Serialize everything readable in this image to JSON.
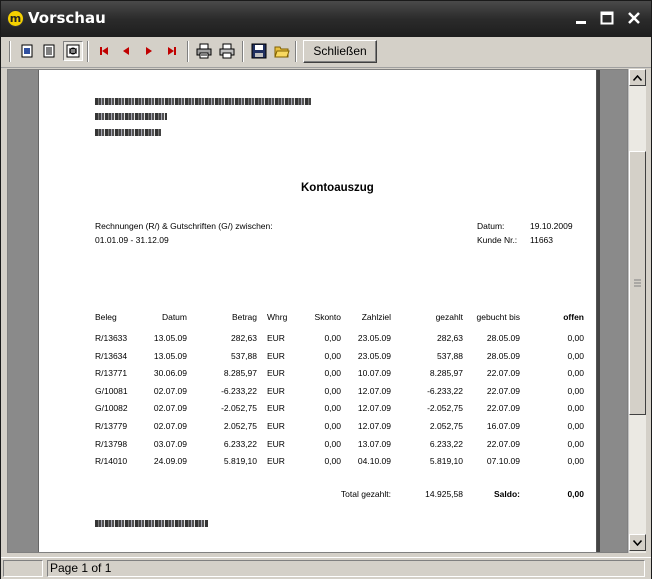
{
  "window": {
    "title": "Vorschau",
    "app_icon_letter": "m"
  },
  "toolbar": {
    "close_label": "Schließen"
  },
  "document": {
    "title": "Kontoauszug",
    "range_label": "Rechnungen (R/) & Gutschriften (G/) zwischen:",
    "range_value": "01.01.09 - 31.12.09",
    "date_label": "Datum:",
    "date_value": "19.10.2009",
    "customer_label": "Kunde Nr.:",
    "customer_value": "11663",
    "columns": [
      "Beleg",
      "Datum",
      "Betrag",
      "Whrg",
      "Skonto",
      "Zahlziel",
      "gezahlt",
      "gebucht bis",
      "offen"
    ],
    "rows": [
      [
        "R/13633",
        "13.05.09",
        "282,63",
        "EUR",
        "0,00",
        "23.05.09",
        "282,63",
        "28.05.09",
        "0,00"
      ],
      [
        "R/13634",
        "13.05.09",
        "537,88",
        "EUR",
        "0,00",
        "23.05.09",
        "537,88",
        "28.05.09",
        "0,00"
      ],
      [
        "R/13771",
        "30.06.09",
        "8.285,97",
        "EUR",
        "0,00",
        "10.07.09",
        "8.285,97",
        "22.07.09",
        "0,00"
      ],
      [
        "G/10081",
        "02.07.09",
        "-6.233,22",
        "EUR",
        "0,00",
        "12.07.09",
        "-6.233,22",
        "22.07.09",
        "0,00"
      ],
      [
        "G/10082",
        "02.07.09",
        "-2.052,75",
        "EUR",
        "0,00",
        "12.07.09",
        "-2.052,75",
        "22.07.09",
        "0,00"
      ],
      [
        "R/13779",
        "02.07.09",
        "2.052,75",
        "EUR",
        "0,00",
        "12.07.09",
        "2.052,75",
        "16.07.09",
        "0,00"
      ],
      [
        "R/13798",
        "03.07.09",
        "6.233,22",
        "EUR",
        "0,00",
        "13.07.09",
        "6.233,22",
        "22.07.09",
        "0,00"
      ],
      [
        "R/14010",
        "24.09.09",
        "5.819,10",
        "EUR",
        "0,00",
        "04.10.09",
        "5.819,10",
        "07.10.09",
        "0,00"
      ]
    ],
    "total_label": "Total gezahlt:",
    "total_value": "14.925,58",
    "saldo_label": "Saldo:",
    "saldo_value": "0,00"
  },
  "statusbar": {
    "page_text": "Page 1 of 1"
  },
  "colors": {
    "titlebar": "#2b2b2b",
    "app_icon": "#f5d100",
    "workspace": "#8a8a8a",
    "nav_arrow": "#c00000"
  },
  "icons": [
    "single-page-icon",
    "multi-page-icon",
    "page-width-icon",
    "first-page-icon",
    "previous-page-icon",
    "next-page-icon",
    "last-page-icon",
    "print-setup-icon",
    "print-icon",
    "save-icon",
    "open-folder-icon"
  ]
}
